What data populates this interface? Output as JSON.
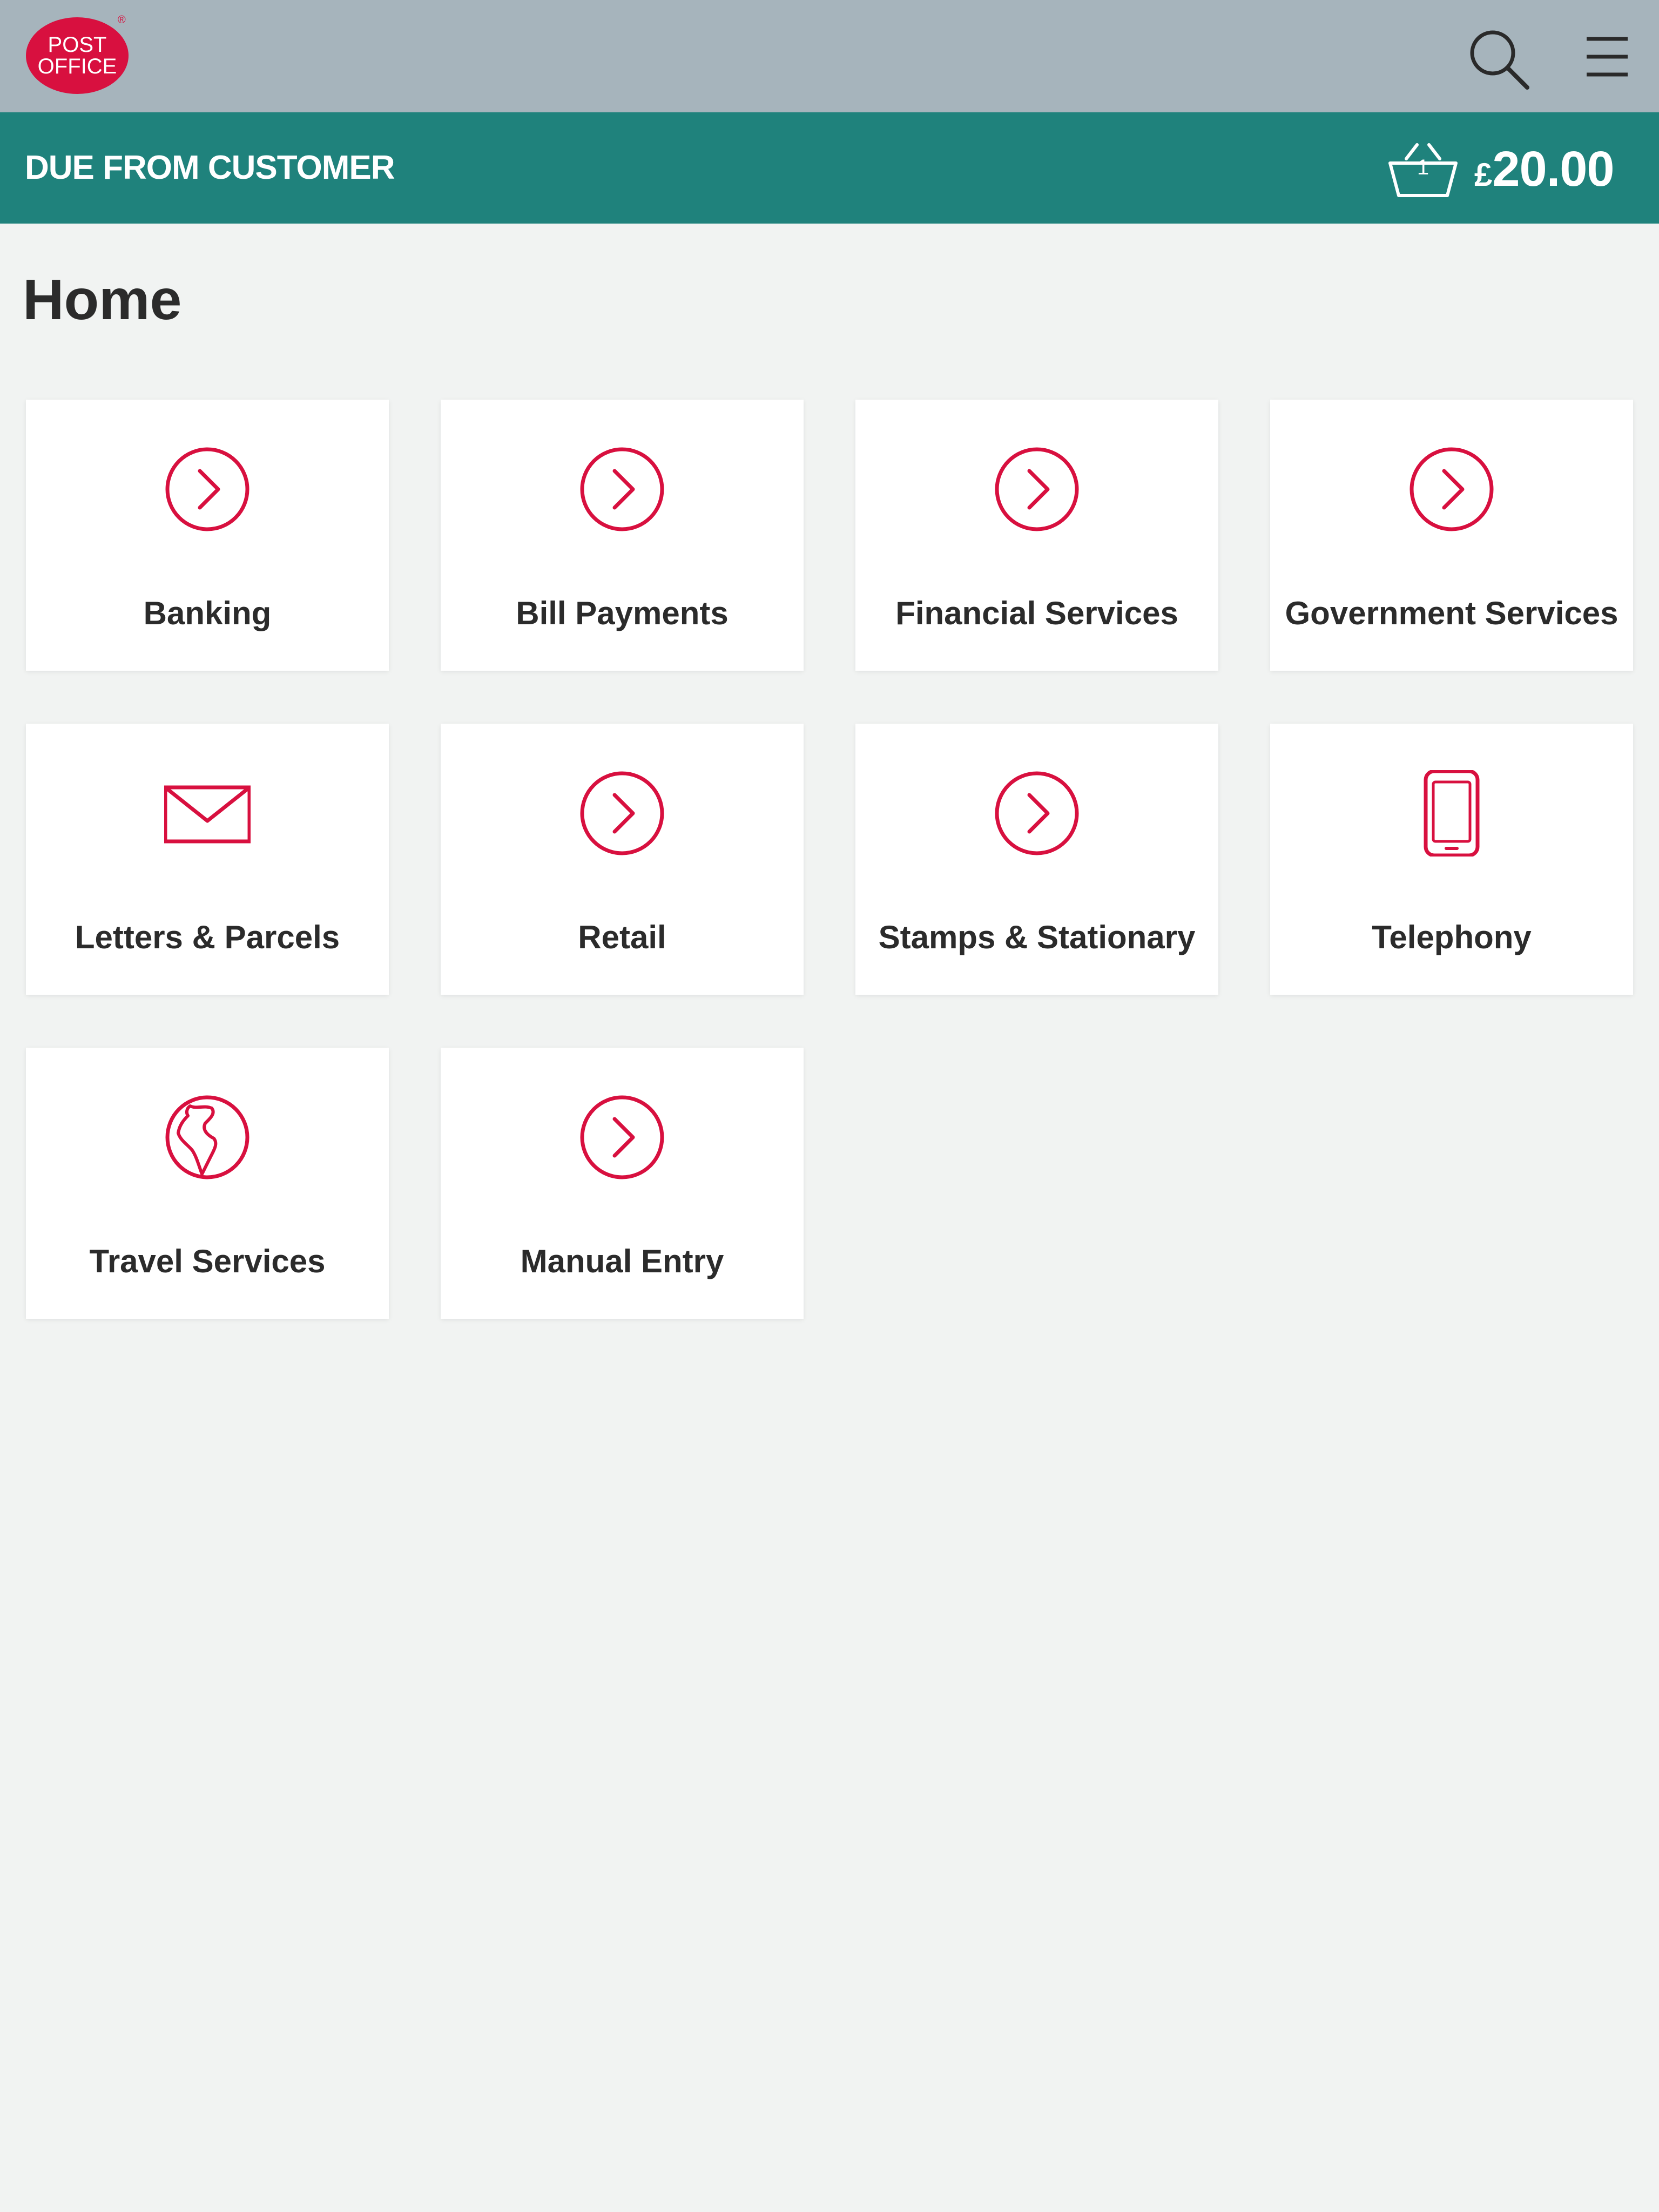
{
  "header": {
    "logo": {
      "line1": "POST",
      "line2": "OFFICE",
      "registered": "®"
    },
    "search_icon": "search-icon",
    "menu_icon": "hamburger-menu-icon"
  },
  "due_bar": {
    "label": "DUE FROM CUSTOMER",
    "basket_count": "1",
    "currency": "£",
    "amount": "20.00"
  },
  "page": {
    "title": "Home"
  },
  "tiles": [
    {
      "label": "Banking",
      "icon": "chevron-circle-icon"
    },
    {
      "label": "Bill Payments",
      "icon": "chevron-circle-icon"
    },
    {
      "label": "Financial Services",
      "icon": "chevron-circle-icon"
    },
    {
      "label": "Government Services",
      "icon": "chevron-circle-icon"
    },
    {
      "label": "Letters & Parcels",
      "icon": "envelope-icon"
    },
    {
      "label": "Retail",
      "icon": "chevron-circle-icon"
    },
    {
      "label": "Stamps & Stationary",
      "icon": "chevron-circle-icon"
    },
    {
      "label": "Telephony",
      "icon": "mobile-phone-icon"
    },
    {
      "label": "Travel Services",
      "icon": "globe-icon"
    },
    {
      "label": "Manual Entry",
      "icon": "chevron-circle-icon"
    }
  ],
  "colors": {
    "header_bg": "#a6b4bc",
    "due_bar_bg": "#1f827c",
    "accent_red": "#d8103f",
    "page_bg": "#f1f3f2"
  }
}
